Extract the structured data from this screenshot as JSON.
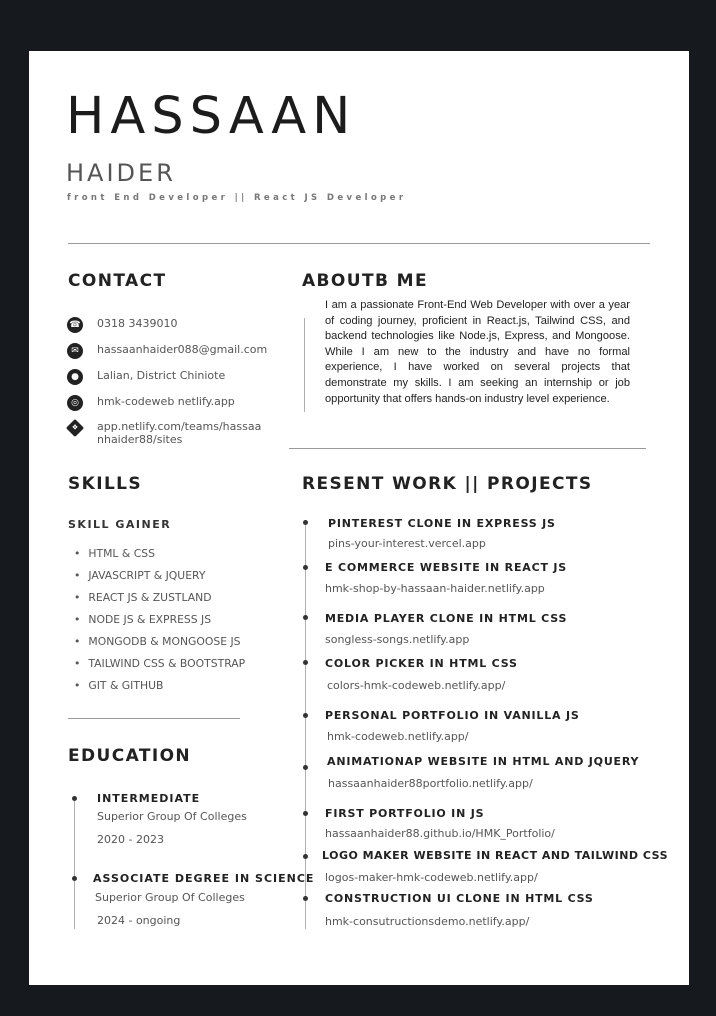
{
  "header": {
    "first_name": "HASSAAN",
    "last_name": "HAIDER",
    "tagline": "front End Developer || React JS Developer"
  },
  "contact": {
    "title": "CONTACT",
    "items": [
      {
        "icon": "phone-icon",
        "text": "0318 3439010"
      },
      {
        "icon": "email-icon",
        "text": "hassaanhaider088@gmail.com"
      },
      {
        "icon": "location-icon",
        "text": "Lalian, District Chiniote"
      },
      {
        "icon": "globe-icon",
        "text": "hmk-codeweb netlify.app"
      },
      {
        "icon": "link-icon",
        "text": "app.netlify.com/teams/hassaa nhaider88/sites"
      }
    ]
  },
  "about": {
    "title": "ABOUTB ME",
    "text": "I am a passionate Front-End Web Developer with over a year of coding journey, proficient in React.js, Tailwind CSS, and backend technologies like Node.js, Express, and Mongoose. While I am new to the industry and have no formal experience, I have worked on several projects that demonstrate my skills. I am seeking an internship or job opportunity that offers hands-on industry level experience."
  },
  "skills": {
    "title": "SKILLS",
    "subtitle": "SKILL GAINER",
    "items": [
      "HTML & CSS",
      "JAVASCRIPT & JQUERY",
      "REACT JS & ZUSTLAND",
      "NODE JS & EXPRESS JS",
      "MONGODB & MONGOOSE JS",
      "TAILWIND CSS & BOOTSTRAP",
      "GIT & GITHUB"
    ]
  },
  "education": {
    "title": "EDUCATION",
    "items": [
      {
        "degree": "INTERMEDIATE",
        "school": "Superior Group Of Colleges",
        "years": "2020 - 2023"
      },
      {
        "degree": "ASSOCIATE DEGREE IN SCIENCE",
        "school": "Superior Group Of Colleges",
        "years": "2024 - ongoing"
      }
    ]
  },
  "projects": {
    "title": "RESENT WORK || PROJECTS",
    "items": [
      {
        "title": "PINTEREST CLONE IN EXPRESS JS",
        "link": "pins-your-interest.vercel.app"
      },
      {
        "title": "E COMMERCE WEBSITE IN REACT JS",
        "link": "hmk-shop-by-hassaan-haider.netlify.app"
      },
      {
        "title": "MEDIA PLAYER CLONE IN HTML CSS",
        "link": "songless-songs.netlify.app"
      },
      {
        "title": "COLOR PICKER IN HTML CSS",
        "link": "colors-hmk-codeweb.netlify.app/"
      },
      {
        "title": "PERSONAL PORTFOLIO IN VANILLA JS",
        "link": "hmk-codeweb.netlify.app/"
      },
      {
        "title": "ANIMATIONAP WEBSITE IN HTML AND JQUERY",
        "link": "hassaanhaider88portfolio.netlify.app/"
      },
      {
        "title": "FIRST PORTFOLIO IN JS",
        "link": "hassaanhaider88.github.io/HMK_Portfolio/"
      },
      {
        "title": "LOGO MAKER WEBSITE IN REACT AND TAILWIND CSS",
        "link": "logos-maker-hmk-codeweb.netlify.app/"
      },
      {
        "title": "CONSTRUCTION UI CLONE IN HTML CSS",
        "link": "hmk-consutructionsdemo.netlify.app/"
      }
    ]
  }
}
